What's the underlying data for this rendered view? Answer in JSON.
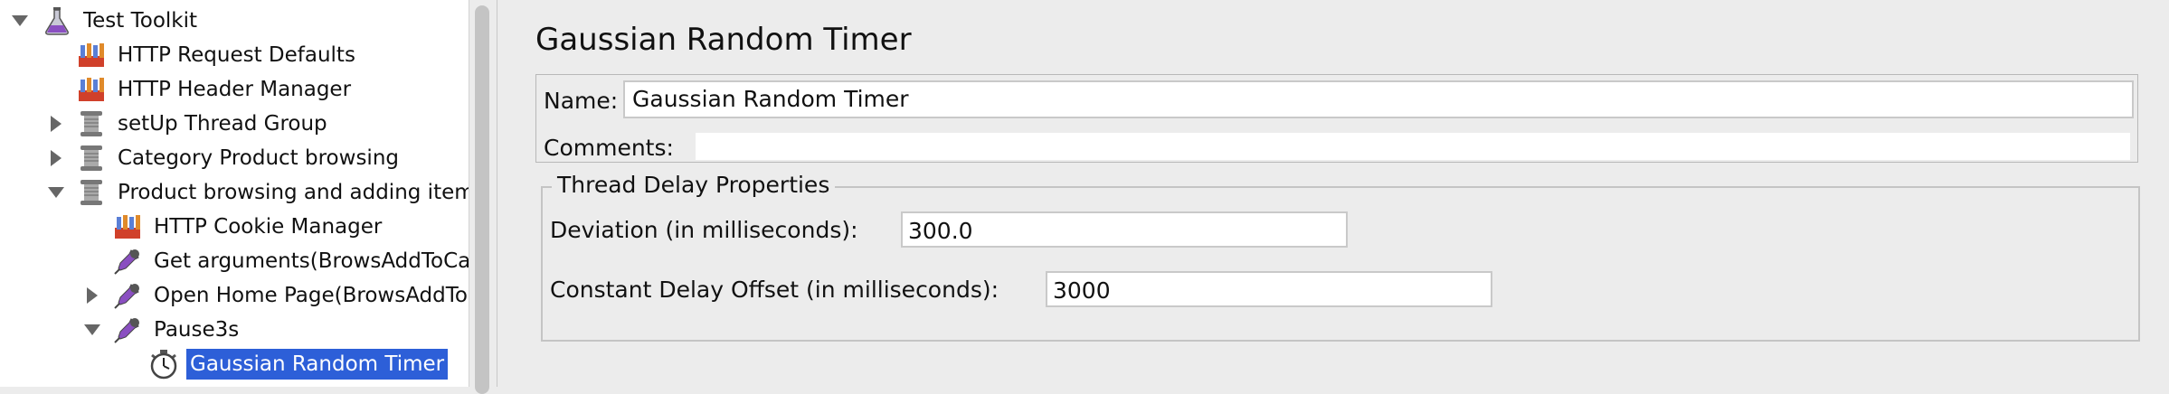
{
  "tree": {
    "items": [
      {
        "label": "Test Toolkit",
        "icon": "test-plan-flask-icon",
        "expander": "expanded"
      },
      {
        "label": "HTTP Request Defaults",
        "icon": "config-element-icon",
        "expander": "none"
      },
      {
        "label": "HTTP Header Manager",
        "icon": "config-element-icon",
        "expander": "none"
      },
      {
        "label": "setUp Thread Group",
        "icon": "thread-group-spool-icon",
        "expander": "collapsed"
      },
      {
        "label": "Category Product browsing",
        "icon": "thread-group-spool-icon",
        "expander": "collapsed"
      },
      {
        "label": "Product browsing and adding items",
        "icon": "thread-group-spool-icon",
        "expander": "expanded"
      },
      {
        "label": "HTTP Cookie Manager",
        "icon": "config-element-icon",
        "expander": "none"
      },
      {
        "label": "Get arguments(BrowsAddToCart",
        "icon": "sampler-pipette-icon",
        "expander": "none"
      },
      {
        "label": "Open Home Page(BrowsAddToCa",
        "icon": "sampler-pipette-icon",
        "expander": "collapsed"
      },
      {
        "label": "Pause3s",
        "icon": "sampler-pipette-icon",
        "expander": "expanded"
      },
      {
        "label": "Gaussian Random Timer",
        "icon": "timer-stopwatch-icon",
        "expander": "none",
        "selected": true
      }
    ]
  },
  "editor": {
    "title": "Gaussian Random Timer",
    "name_label": "Name:",
    "name_value": "Gaussian Random Timer",
    "comments_label": "Comments:",
    "comments_value": "",
    "group_title": "Thread Delay Properties",
    "deviation_label": "Deviation (in milliseconds):",
    "deviation_value": "300.0",
    "offset_label": "Constant Delay Offset (in milliseconds):",
    "offset_value": "3000"
  },
  "colors": {
    "selection": "#2d5fd8",
    "panel_background": "#ececec",
    "tree_background": "#ffffff"
  }
}
